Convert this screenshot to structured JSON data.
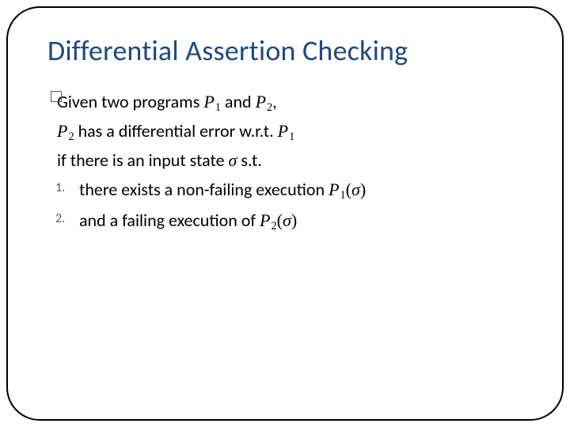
{
  "title": "Differential Assertion Checking",
  "body": {
    "l1a": "Given two programs ",
    "p1": "P",
    "sub1": "1",
    "l1b": " and ",
    "p2": "P",
    "sub2": "2",
    "l1c": ",",
    "l2a": "P",
    "l2sub": "2",
    "l2b": " has a differential error w.r.t. ",
    "l2c": "P",
    "l2sub2": "1",
    "l3a": "if there is an input state ",
    "sigma": "σ",
    "l3b": " s.t.",
    "n1": "1.",
    "item1a": "there exists a non-failing execution ",
    "item1P": "P",
    "item1sub": "1",
    "item1lp": "(",
    "item1sig": "σ",
    "item1rp": ")",
    "n2": "2.",
    "item2a": "and a failing execution of ",
    "item2P": "P",
    "item2sub": "2",
    "item2lp": "(",
    "item2sig": "σ",
    "item2rp": ")"
  }
}
